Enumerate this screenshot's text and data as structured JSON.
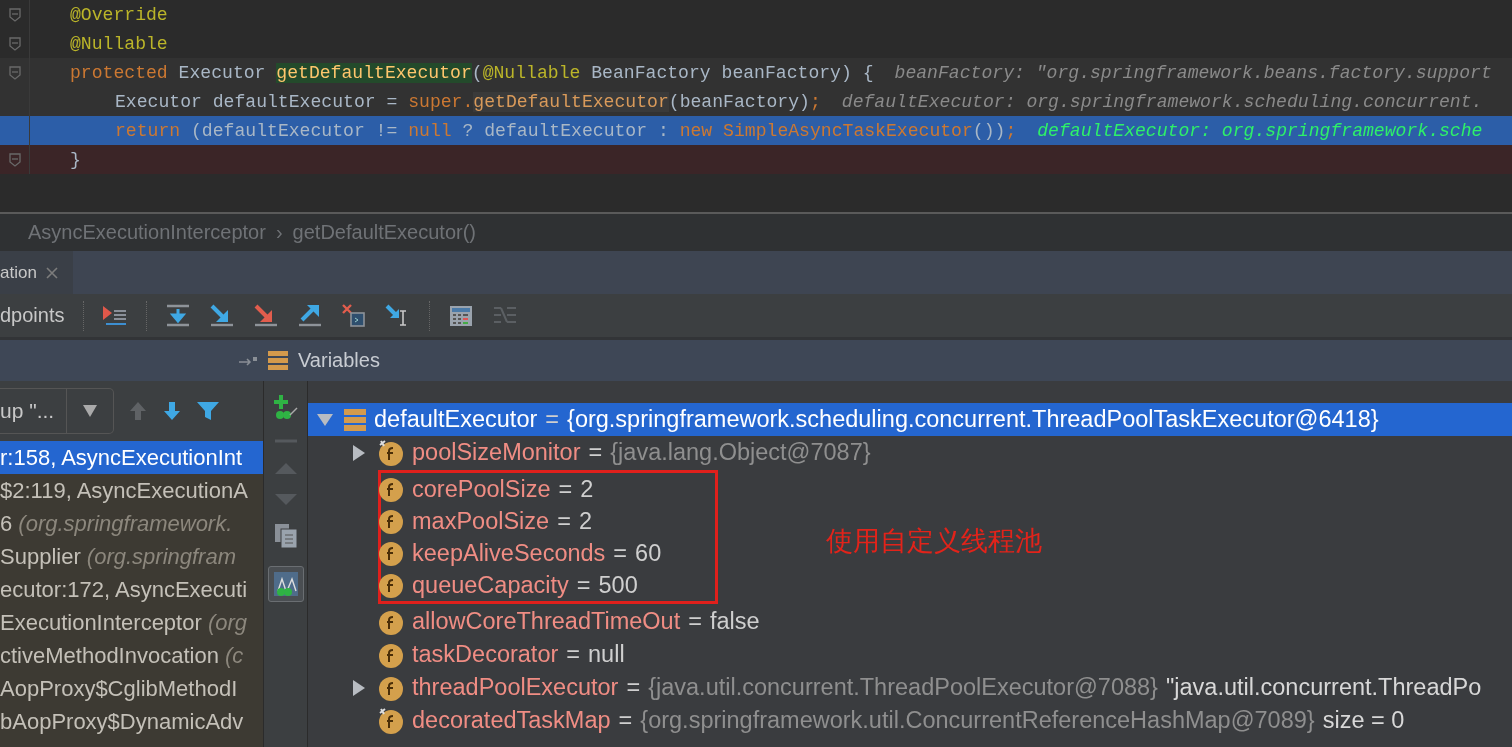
{
  "editor": {
    "lines": [
      {
        "kind": "plain",
        "fold": true,
        "tokens": [
          {
            "t": "@Override",
            "kind": "annotation"
          }
        ]
      },
      {
        "kind": "plain",
        "fold": true,
        "tokens": [
          {
            "t": "@Nullable",
            "kind": "annotation"
          }
        ]
      },
      {
        "kind": "current",
        "fold": true,
        "tokens": [
          {
            "t": "protected",
            "kind": "keyword"
          },
          {
            "t": " Executor ",
            "kind": "plain"
          },
          {
            "t": "getDefaultExecutor",
            "kind": "declaration"
          },
          {
            "t": "(",
            "kind": "plain"
          },
          {
            "t": "@Nullable",
            "kind": "annotation"
          },
          {
            "t": " BeanFactory beanFactory) {",
            "kind": "plain"
          }
        ],
        "hint": "beanFactory: \"org.springframework.beans.factory.support",
        "children": [
          {
            "kind": "current",
            "fold": false,
            "tokens": [
              {
                "t": "Executor defaultExecutor = ",
                "kind": "plain"
              },
              {
                "t": "super.",
                "kind": "keyword"
              },
              {
                "t": "getDefaultExecutor",
                "kind": "call"
              },
              {
                "t": "(beanFactory)",
                "kind": "plain"
              },
              {
                "t": ";",
                "kind": "keyword"
              }
            ],
            "hint": "defaultExecutor: org.springframework.scheduling.concurrent."
          },
          {
            "kind": "execution",
            "fold": false,
            "tokens": [
              {
                "t": "return",
                "kind": "keyword"
              },
              {
                "t": " (defaultExecutor != ",
                "kind": "plain"
              },
              {
                "t": "null",
                "kind": "keyword"
              },
              {
                "t": " ? defaultExecutor : ",
                "kind": "plain"
              },
              {
                "t": "new",
                "kind": "keyword"
              },
              {
                "t": " SimpleAsyncTaskExecutor",
                "kind": "keyword"
              },
              {
                "t": "())",
                "kind": "plain"
              },
              {
                "t": ";",
                "kind": "keyword"
              }
            ],
            "hint": "defaultExecutor: org.springframework.sche"
          }
        ]
      },
      {
        "kind": "breakpoint",
        "fold": true,
        "tokens": [
          {
            "t": "}",
            "kind": "plain"
          }
        ]
      }
    ]
  },
  "breadcrumb": {
    "items": [
      "AsyncExecutionInterceptor",
      "getDefaultExecutor()"
    ],
    "separator": "›"
  },
  "tabs": [
    {
      "label": "ation",
      "selected": true
    }
  ],
  "toolbar": {
    "label": "dpoints"
  },
  "variables_header": {
    "title": "Variables"
  },
  "frames": {
    "thread_selector": "up \"...",
    "items": [
      {
        "text": "r:158, AsyncExecutionInt",
        "selected": true
      },
      {
        "text": "$2:119, AsyncExecutionA",
        "selected": false
      },
      {
        "text": "6 ",
        "detail": "(org.springframework.",
        "selected": false
      },
      {
        "text": "Supplier ",
        "detail": "(org.springfram",
        "selected": false
      },
      {
        "text": "ecutor:172, AsyncExecuti",
        "selected": false
      },
      {
        "text": "ExecutionInterceptor ",
        "detail": "(org",
        "selected": false
      },
      {
        "text": "ctiveMethodInvocation ",
        "detail": "(c",
        "selected": false
      },
      {
        "text": "AopProxy$CglibMethodI",
        "selected": false
      },
      {
        "text": "bAopProxy$DynamicAdv",
        "selected": false
      }
    ]
  },
  "variables": [
    {
      "name": "defaultExecutor",
      "separator": "=",
      "value": "{org.springframework.scheduling.concurrent.ThreadPoolTaskExecutor@6418}",
      "kind": "object",
      "expandable": true,
      "expanded": true,
      "selected": true,
      "children": [
        {
          "name": "poolSizeMonitor",
          "separator": "=",
          "value": "{java.lang.Object@7087}",
          "value_is_ref": true,
          "kind": "field",
          "expandable": true,
          "expanded": false,
          "selected": false,
          "final": true,
          "highlighted": false
        },
        {
          "name": "corePoolSize",
          "separator": "=",
          "value": "2",
          "value_is_ref": false,
          "kind": "field",
          "expandable": false,
          "selected": false,
          "final": false,
          "highlighted": true
        },
        {
          "name": "maxPoolSize",
          "separator": "=",
          "value": "2",
          "value_is_ref": false,
          "kind": "field",
          "expandable": false,
          "selected": false,
          "final": false,
          "highlighted": true
        },
        {
          "name": "keepAliveSeconds",
          "separator": "=",
          "value": "60",
          "value_is_ref": false,
          "kind": "field",
          "expandable": false,
          "selected": false,
          "final": false,
          "highlighted": true
        },
        {
          "name": "queueCapacity",
          "separator": "=",
          "value": "500",
          "value_is_ref": false,
          "kind": "field",
          "expandable": false,
          "selected": false,
          "final": false,
          "highlighted": true
        },
        {
          "name": "allowCoreThreadTimeOut",
          "separator": "=",
          "value": "false",
          "value_is_ref": false,
          "kind": "field",
          "expandable": false,
          "selected": false,
          "final": false,
          "highlighted": false
        },
        {
          "name": "taskDecorator",
          "separator": "=",
          "value": "null",
          "value_is_ref": false,
          "kind": "field",
          "expandable": false,
          "selected": false,
          "final": false,
          "highlighted": false
        },
        {
          "name": "threadPoolExecutor",
          "separator": "=",
          "value": "{java.util.concurrent.ThreadPoolExecutor@7088}",
          "value_is_ref": true,
          "note": "\"java.util.concurrent.ThreadPo",
          "kind": "field",
          "expandable": true,
          "expanded": false,
          "selected": false,
          "final": false,
          "highlighted": false
        },
        {
          "name": "decoratedTaskMap",
          "separator": "=",
          "value": "{org.springframework.util.ConcurrentReferenceHashMap@7089}",
          "value_is_ref": true,
          "note": "size = 0",
          "kind": "field",
          "expandable": false,
          "selected": false,
          "final": true,
          "highlighted": false
        }
      ]
    }
  ],
  "annotation": {
    "text": "使用自定义线程池"
  }
}
